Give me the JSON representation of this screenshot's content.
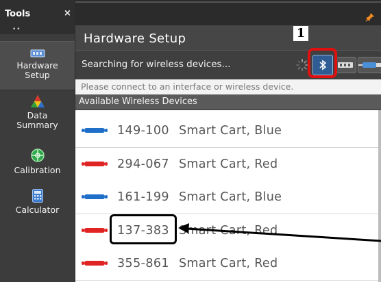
{
  "tools": {
    "title": "Tools",
    "close": "×",
    "grip": "••",
    "items": [
      {
        "label_line1": "Hardware",
        "label_line2": "Setup",
        "icon": "hardware-setup-icon"
      },
      {
        "label_line1": "Data",
        "label_line2": "Summary",
        "icon": "data-summary-icon"
      },
      {
        "label_line1": "Calibration",
        "label_line2": "",
        "icon": "calibration-icon"
      },
      {
        "label_line1": "Calculator",
        "label_line2": "",
        "icon": "calculator-icon"
      }
    ]
  },
  "hardware_setup": {
    "title": "Hardware Setup",
    "status": "Searching for wireless devices...",
    "bluetooth_glyph": "✱",
    "hint": "Please connect to an interface or wireless device.",
    "list_header": "Available Wireless Devices",
    "devices": [
      {
        "id": "149-100",
        "name": "Smart Cart, Blue",
        "color": "#1f6fc8"
      },
      {
        "id": "294-067",
        "name": "Smart Cart, Red",
        "color": "#e02424"
      },
      {
        "id": "161-199",
        "name": "Smart Cart, Blue",
        "color": "#1f6fc8"
      },
      {
        "id": "137-383",
        "name": "Smart Cart, Red",
        "color": "#e02424"
      },
      {
        "id": "355-861",
        "name": "Smart Cart, Red",
        "color": "#e02424"
      }
    ]
  },
  "annotations": {
    "step_number": "1"
  },
  "colors": {
    "accent_pin": "#f08a24",
    "highlight_red": "#e01010",
    "bluetooth_blue": "#2f5d93"
  }
}
